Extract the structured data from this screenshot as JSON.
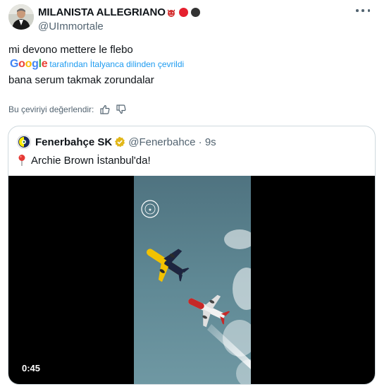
{
  "tweet": {
    "author_name": "MILANISTA ALLEGRIANO",
    "author_handle": "@UImmortale",
    "text": "mi devono mettere le flebo",
    "translate": {
      "provider": "Google",
      "label": "tarafından İtalyanca dilinden çevrildi"
    },
    "translated_text": "bana serum takmak zorundalar",
    "rate_label": "Bu çeviriyi değerlendir:"
  },
  "quoted": {
    "name": "Fenerbahçe SK",
    "handle_time": "@Fenerbahce · 9s",
    "text": "Archie Brown İstanbul'da!",
    "video_duration": "0:45"
  },
  "colors": {
    "accent": "#1d9bf0",
    "muted": "#536471",
    "border": "#cfd9de",
    "badge_red": "#e5202e",
    "badge_dark": "#333333",
    "verified_gold": "#e2b719"
  },
  "icons": {
    "more": "more-horizontal-icon",
    "thumbs_up": "thumbs-up-icon",
    "thumbs_down": "thumbs-down-icon",
    "verified": "verified-badge-icon",
    "pin": "round-pushpin-icon"
  }
}
